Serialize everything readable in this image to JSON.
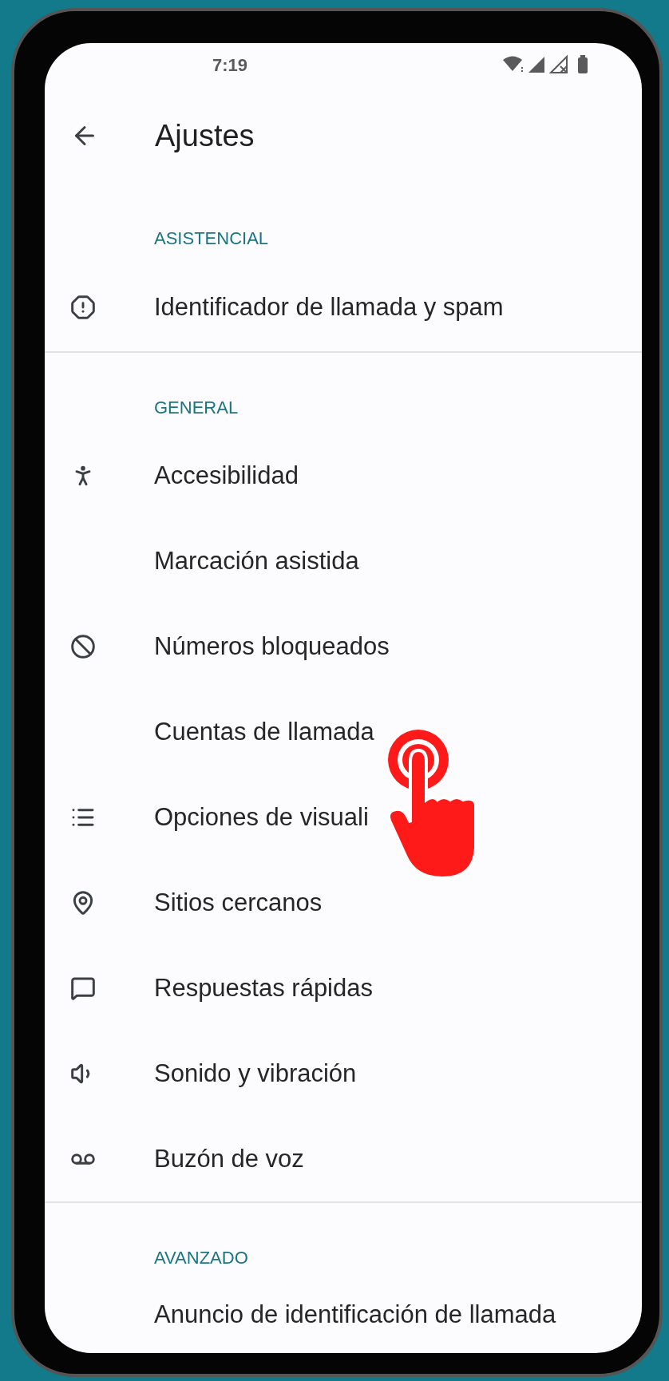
{
  "status_bar": {
    "time": "7:19"
  },
  "toolbar": {
    "title": "Ajustes"
  },
  "sections": [
    {
      "header": "ASISTENCIAL",
      "items": [
        {
          "label": "Identificador de llamada y spam",
          "tap_indicator": false
        }
      ]
    },
    {
      "header": "GENERAL",
      "items": [
        {
          "label": "Accesibilidad",
          "tap_indicator": false
        },
        {
          "label": "Marcación asistida",
          "tap_indicator": false
        },
        {
          "label": "Números bloqueados",
          "tap_indicator": false
        },
        {
          "label": "Cuentas de llamada",
          "tap_indicator": false
        },
        {
          "label": "Opciones de visuali",
          "tap_indicator": true
        },
        {
          "label": "Sitios cercanos",
          "tap_indicator": false
        },
        {
          "label": "Respuestas rápidas",
          "tap_indicator": false
        },
        {
          "label": "Sonido y vibración",
          "tap_indicator": false
        },
        {
          "label": "Buzón de voz",
          "tap_indicator": false
        }
      ]
    },
    {
      "header": "AVANZADO",
      "items": [
        {
          "label": "Anuncio de identificación de llamada",
          "tap_indicator": false
        }
      ]
    }
  ]
}
